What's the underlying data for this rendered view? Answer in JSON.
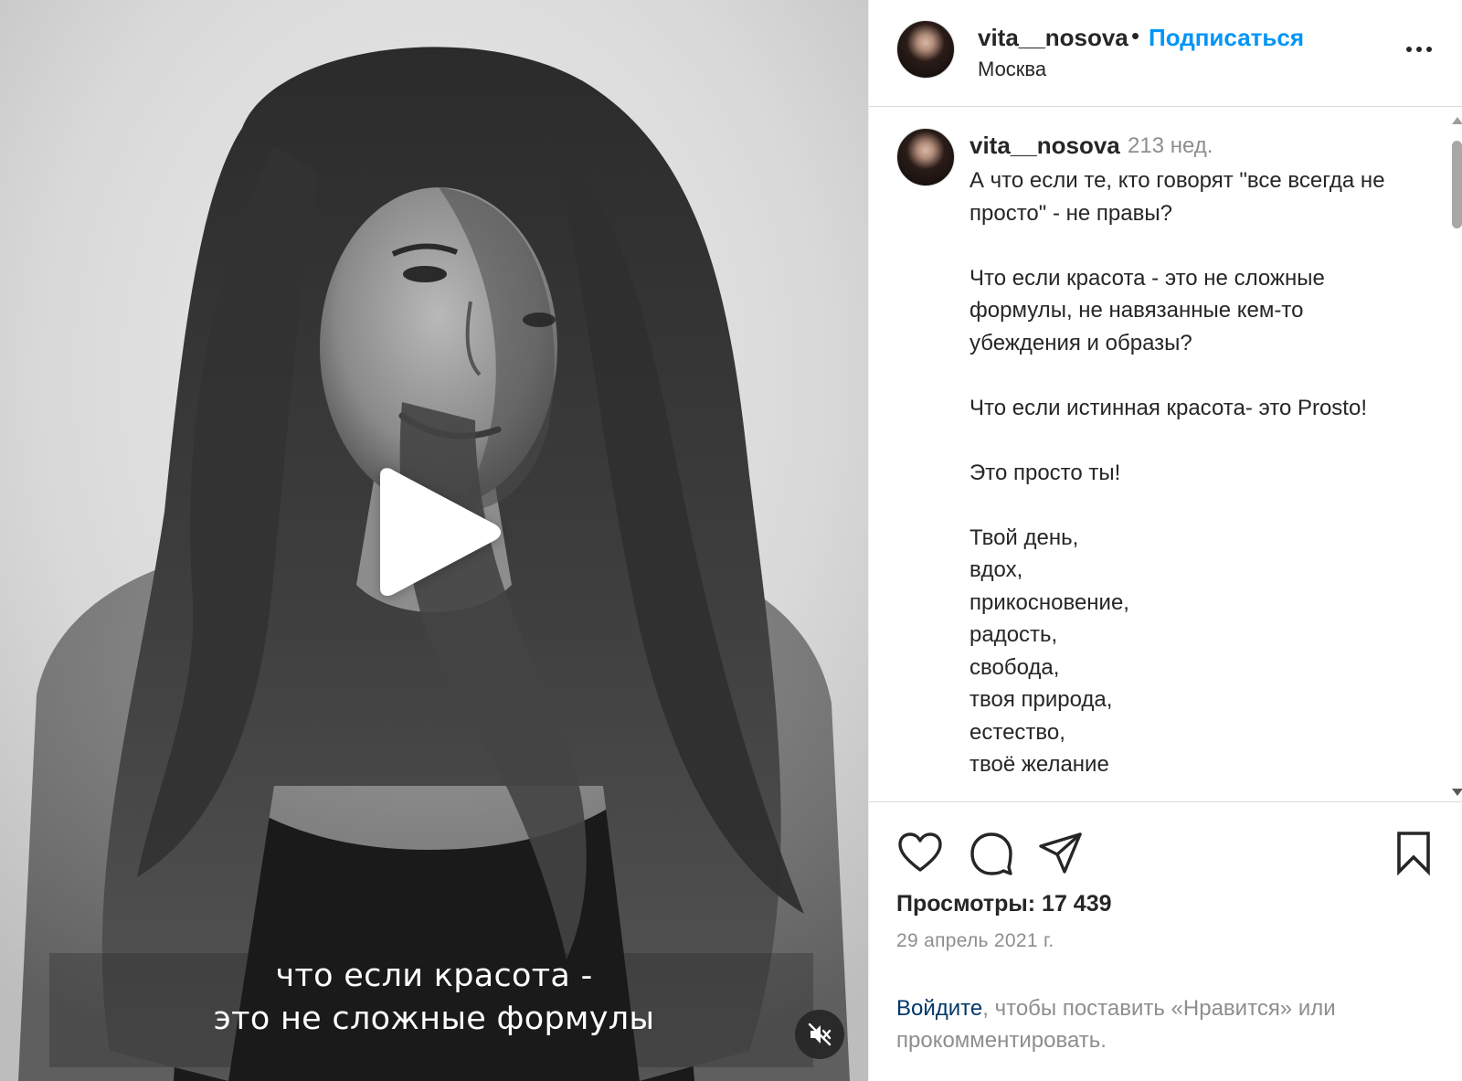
{
  "header": {
    "username": "vita__nosova",
    "separator": "•",
    "follow_label": "Подписаться",
    "location": "Москва"
  },
  "post": {
    "username": "vita__nosova",
    "time": "213 нед.",
    "text": "А что если те, кто говорят \"все всегда не просто\" - не правы?\n\nЧто если красота - это не сложные формулы, не навязанные кем-то убеждения и образы?\n\nЧто если истинная красота- это Prosto!\n\nЭто просто ты!\n\nТвой день,\nвдох,\nприкосновение,\nрадость,\nсвобода,\nтвоя природа,\nестество,\nтвоё желание"
  },
  "video": {
    "caption_line1": "что если красота -",
    "caption_line2": "это не сложные формулы",
    "muted": true
  },
  "stats": {
    "views_label": "Просмотры:",
    "views_value": "17 439",
    "date": "29 апрель 2021 г."
  },
  "login_prompt": {
    "link": "Войдите",
    "rest": ", чтобы поставить «Нравится» или прокомментировать."
  },
  "icons": {
    "like": "heart-icon",
    "comment": "comment-icon",
    "share": "paper-plane-icon",
    "save": "bookmark-icon",
    "more": "more-icon",
    "play": "play-icon",
    "mute": "muted-speaker-icon"
  },
  "colors": {
    "link_blue": "#0095f6",
    "muted_text": "#8e8e8e",
    "text": "#262626",
    "login_link": "#00376b"
  }
}
